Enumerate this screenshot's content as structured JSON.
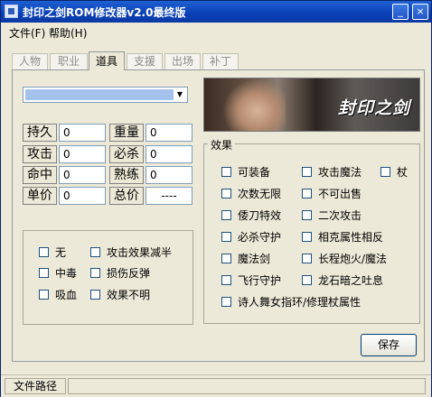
{
  "window": {
    "title": "封印之剑ROM修改器v2.0最终版",
    "minimize": "_",
    "close": "×"
  },
  "menu": [
    {
      "label": "文件(F)"
    },
    {
      "label": "帮助(H)"
    }
  ],
  "tabs": [
    {
      "label": "人物"
    },
    {
      "label": "职业"
    },
    {
      "label": "道具"
    },
    {
      "label": "支援"
    },
    {
      "label": "出场"
    },
    {
      "label": "补丁"
    }
  ],
  "active_tab": "道具",
  "item_select": {
    "value": ""
  },
  "banner": {
    "text": "封印之剑"
  },
  "stats": {
    "durability": {
      "label": "持久",
      "value": "0"
    },
    "weight": {
      "label": "重量",
      "value": "0"
    },
    "attack": {
      "label": "攻击",
      "value": "0"
    },
    "critical": {
      "label": "必杀",
      "value": "0"
    },
    "hit": {
      "label": "命中",
      "value": "0"
    },
    "skill": {
      "label": "熟练",
      "value": "0"
    },
    "unit_price": {
      "label": "单价",
      "value": "0"
    },
    "total_price": {
      "label": "总价",
      "value": "----"
    }
  },
  "effects_left": [
    {
      "label": "无",
      "checked": false
    },
    {
      "label": "攻击效果减半",
      "checked": false
    },
    {
      "label": "中毒",
      "checked": false
    },
    {
      "label": "损伤反弹",
      "checked": false
    },
    {
      "label": "吸血",
      "checked": false
    },
    {
      "label": "效果不明",
      "checked": false
    }
  ],
  "effects_group": {
    "title": "效果",
    "items": [
      {
        "label": "可装备",
        "checked": false
      },
      {
        "label": "攻击魔法",
        "checked": false
      },
      {
        "label": "杖",
        "checked": false
      },
      {
        "label": "次数无限",
        "checked": false
      },
      {
        "label": "不可出售",
        "checked": false
      },
      {
        "label": "倭刀特效",
        "checked": false
      },
      {
        "label": "二次攻击",
        "checked": false
      },
      {
        "label": "必杀守护",
        "checked": false
      },
      {
        "label": "相克属性相反",
        "checked": false
      },
      {
        "label": "魔法剑",
        "checked": false
      },
      {
        "label": "长程炮火/魔法",
        "checked": false
      },
      {
        "label": "飞行守护",
        "checked": false
      },
      {
        "label": "龙石暗之吐息",
        "checked": false
      },
      {
        "label": "诗人舞女指环/修理杖属性",
        "checked": false
      }
    ]
  },
  "save_button": "保存",
  "status_bar": {
    "file_path_label": "文件路径",
    "file_path_value": ""
  }
}
